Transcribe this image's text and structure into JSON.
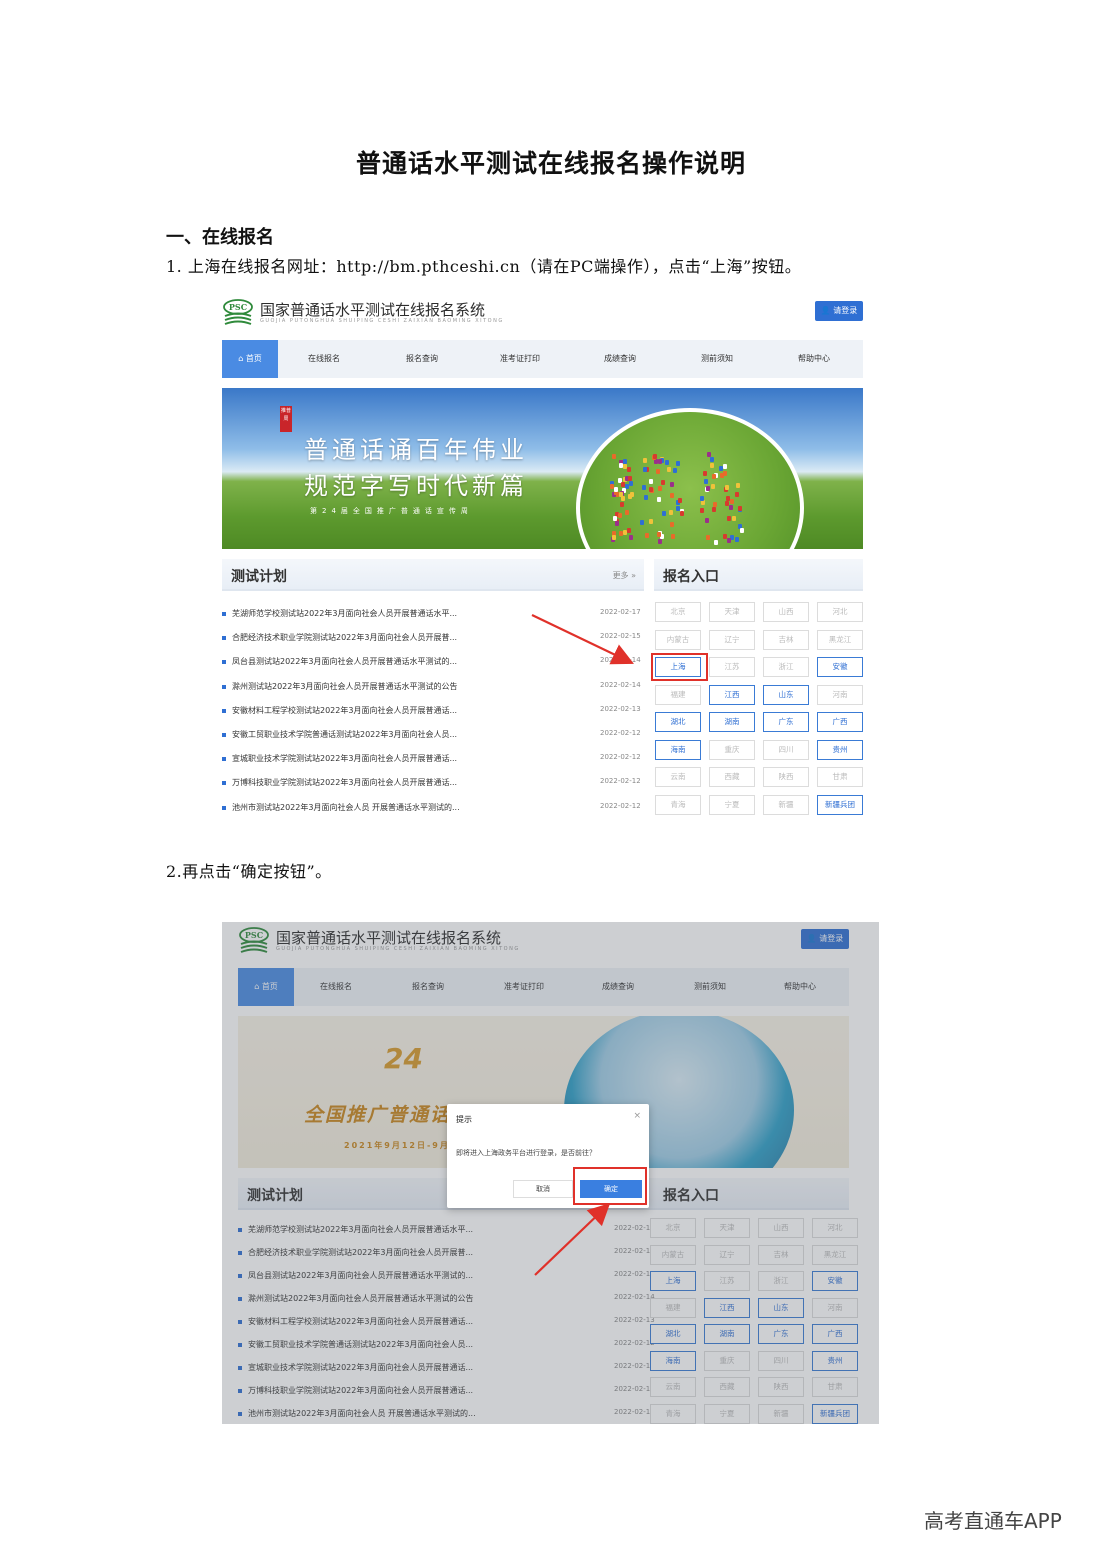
{
  "document": {
    "title": "普通话水平测试在线报名操作说明",
    "section_heading": "一、在线报名",
    "step1_text": "1. 上海在线报名网址：http://bm.pthceshi.cn（请在PC端操作），点击“上海”按钮。",
    "step2_text": "2.再点击“确定按钮”。",
    "watermark": "高考直通车APP"
  },
  "site": {
    "logo_mark": "PSC",
    "title": "国家普通话水平测试在线报名系统",
    "subtitle": "GUOJIA PUTONGHUA SHUIPING CESHI ZAIXIAN BAOMING XITONG",
    "login_label": "请登录",
    "nav": [
      "首页",
      "在线报名",
      "报名查询",
      "准考证打印",
      "成绩查询",
      "测前须知",
      "帮助中心"
    ],
    "banner1": {
      "seal": "推普周",
      "line1": "普通话诵百年伟业",
      "line2": "规范字写时代新篇",
      "line3": "第24届全国推广普通话宣传周"
    },
    "banner2": {
      "number": "24",
      "slogan": "全国推广普通话",
      "date": "2021年9月12日-9月"
    },
    "test_plan": {
      "title": "测试计划",
      "more": "更多 »",
      "items": [
        {
          "text": "芜湖师范学校测试站2022年3月面向社会人员开展普通话水平...",
          "date": "2022-02-17"
        },
        {
          "text": "合肥经济技术职业学院测试站2022年3月面向社会人员开展普...",
          "date": "2022-02-15"
        },
        {
          "text": "凤台县测试站2022年3月面向社会人员开展普通话水平测试的...",
          "date": "2022-02-14"
        },
        {
          "text": "滁州测试站2022年3月面向社会人员开展普通话水平测试的公告",
          "date": "2022-02-14"
        },
        {
          "text": "安徽材料工程学校测试站2022年3月面向社会人员开展普通话...",
          "date": "2022-02-13"
        },
        {
          "text": "安徽工贸职业技术学院普通话测试站2022年3月面向社会人员...",
          "date": "2022-02-12"
        },
        {
          "text": "宣城职业技术学院测试站2022年3月面向社会人员开展普通话...",
          "date": "2022-02-12"
        },
        {
          "text": "万博科技职业学院测试站2022年3月面向社会人员开展普通话...",
          "date": "2022-02-12"
        },
        {
          "text": "池州市测试站2022年3月面向社会人员 开展普通话水平测试的...",
          "date": "2022-02-12"
        }
      ]
    },
    "entry": {
      "title": "报名入口",
      "provinces": [
        {
          "name": "北京",
          "active": false
        },
        {
          "name": "天津",
          "active": false
        },
        {
          "name": "山西",
          "active": false
        },
        {
          "name": "河北",
          "active": false
        },
        {
          "name": "内蒙古",
          "active": false
        },
        {
          "name": "辽宁",
          "active": false
        },
        {
          "name": "吉林",
          "active": false
        },
        {
          "name": "黑龙江",
          "active": false
        },
        {
          "name": "上海",
          "active": true
        },
        {
          "name": "江苏",
          "active": false
        },
        {
          "name": "浙江",
          "active": false
        },
        {
          "name": "安徽",
          "active": true
        },
        {
          "name": "福建",
          "active": false
        },
        {
          "name": "江西",
          "active": true
        },
        {
          "name": "山东",
          "active": true
        },
        {
          "name": "河南",
          "active": false
        },
        {
          "name": "湖北",
          "active": true
        },
        {
          "name": "湖南",
          "active": true
        },
        {
          "name": "广东",
          "active": true
        },
        {
          "name": "广西",
          "active": true
        },
        {
          "name": "海南",
          "active": true
        },
        {
          "name": "重庆",
          "active": false
        },
        {
          "name": "四川",
          "active": false
        },
        {
          "name": "贵州",
          "active": true
        },
        {
          "name": "云南",
          "active": false
        },
        {
          "name": "西藏",
          "active": false
        },
        {
          "name": "陕西",
          "active": false
        },
        {
          "name": "甘肃",
          "active": false
        },
        {
          "name": "青海",
          "active": false
        },
        {
          "name": "宁夏",
          "active": false
        },
        {
          "name": "新疆",
          "active": false
        },
        {
          "name": "新疆兵团",
          "active": true
        }
      ]
    },
    "dialog": {
      "title": "提示",
      "close": "×",
      "message": "即将进入上海政务平台进行登录，是否前往？",
      "cancel": "取消",
      "ok": "确定"
    }
  },
  "colors": {
    "brand_blue": "#2f6fd3",
    "highlight_red": "#e0312a",
    "nav_bg": "#eef2f7"
  }
}
